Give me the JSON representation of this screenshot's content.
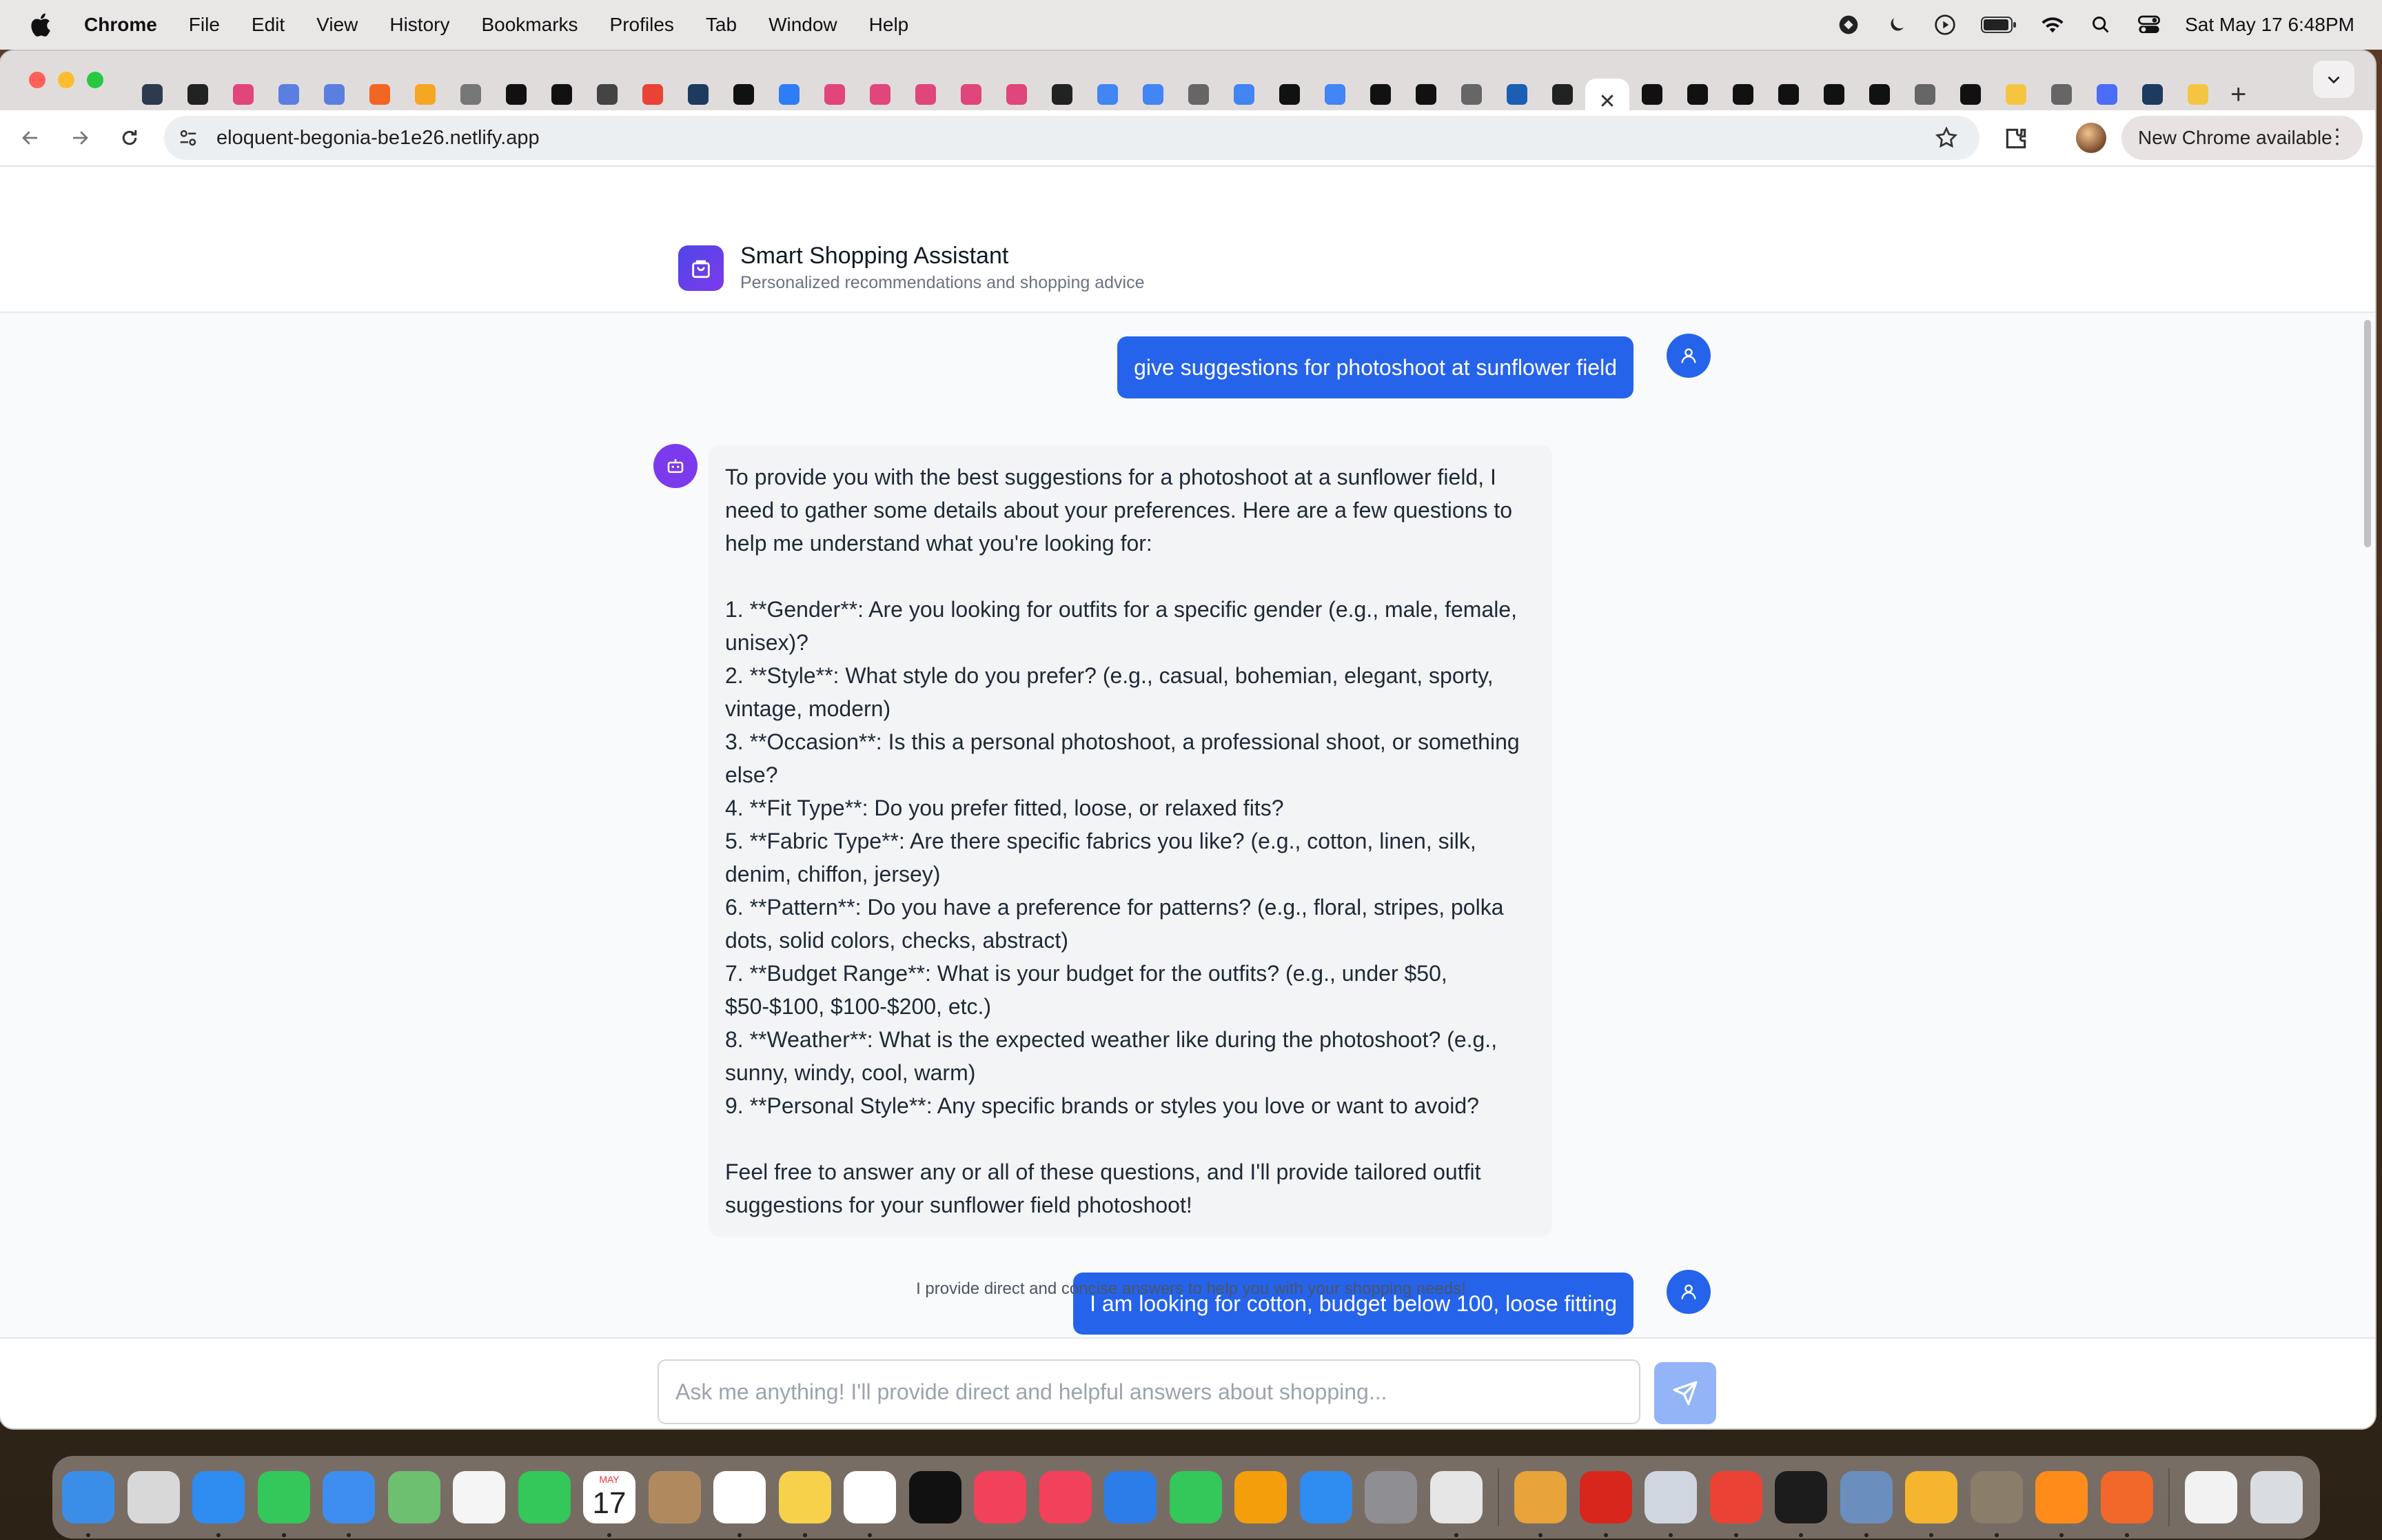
{
  "menubar": {
    "app_name": "Chrome",
    "items": [
      "File",
      "Edit",
      "View",
      "History",
      "Bookmarks",
      "Profiles",
      "Tab",
      "Window",
      "Help"
    ],
    "clock": "Sat May 17  6:48PM"
  },
  "browser": {
    "url": "eloquent-begonia-be1e26.netlify.app",
    "update_label": "New Chrome available",
    "active_tab_close": "✕",
    "new_tab": "+"
  },
  "tab_favicons": [
    "#2e3b4e",
    "#222222",
    "#e0457b",
    "#5b7fe0",
    "#5b7fe0",
    "#f26522",
    "#f5a623",
    "#777777",
    "#111111",
    "#111111",
    "#444444",
    "#ea4335",
    "#1e3a5f",
    "#111111",
    "#2f7df6",
    "#e0457b",
    "#e0457b",
    "#e0457b",
    "#e0457b",
    "#e0457b",
    "#222222",
    "#4285f4",
    "#4285f4",
    "#666666",
    "#4285f4",
    "#111111",
    "#4285f4",
    "#111111",
    "#111111",
    "#666666",
    "#1a5fb4",
    "#222222"
  ],
  "tab_favicons_after": [
    "#111111",
    "#111111",
    "#111111",
    "#111111",
    "#111111",
    "#111111",
    "#666666",
    "#111111",
    "#f5c542",
    "#666666",
    "#4a6cf7",
    "#1e3a5f",
    "#f5c542"
  ],
  "app": {
    "title": "Smart Shopping Assistant",
    "subtitle": "Personalized recommendations and shopping advice"
  },
  "messages": {
    "user_1": "give suggestions for photoshoot at sunflower field",
    "bot_1": "To provide you with the best suggestions for a photoshoot at a sunflower field, I need to gather some details about your preferences. Here are a few questions to help me understand what you're looking for:\n\n1. **Gender**: Are you looking for outfits for a specific gender (e.g., male, female, unisex)?\n2. **Style**: What style do you prefer? (e.g., casual, bohemian, elegant, sporty, vintage, modern)\n3. **Occasion**: Is this a personal photoshoot, a professional shoot, or something else?\n4. **Fit Type**: Do you prefer fitted, loose, or relaxed fits?\n5. **Fabric Type**: Are there specific fabrics you like? (e.g., cotton, linen, silk, denim, chiffon, jersey)\n6. **Pattern**: Do you have a preference for patterns? (e.g., floral, stripes, polka dots, solid colors, checks, abstract)\n7. **Budget Range**: What is your budget for the outfits? (e.g., under $50, $50-$100, $100-$200, etc.)\n8. **Weather**: What is the expected weather like during the photoshoot? (e.g., sunny, windy, cool, warm)\n9. **Personal Style**: Any specific brands or styles you love or want to avoid?\n\nFeel free to answer any or all of these questions, and I'll provide tailored outfit suggestions for your sunflower field photoshoot!",
    "user_2": "I am looking for cotton, budget below 100, loose fitting"
  },
  "composer": {
    "placeholder": "Ask me anything! I'll provide direct and helpful answers about shopping...",
    "value": "",
    "hint": "I provide direct and concise answers to help you with your shopping needs!"
  },
  "dock": {
    "calendar_month": "MAY",
    "calendar_day": "17",
    "apps": [
      {
        "name": "finder",
        "color": "#3b8ee8"
      },
      {
        "name": "launchpad",
        "color": "#d8d8d8"
      },
      {
        "name": "safari",
        "color": "#2f8cf0"
      },
      {
        "name": "messages",
        "color": "#34c759"
      },
      {
        "name": "mail",
        "color": "#3d8ef0"
      },
      {
        "name": "maps",
        "color": "#6cc070"
      },
      {
        "name": "photos",
        "color": "#f5f5f5"
      },
      {
        "name": "facetime",
        "color": "#34c759"
      },
      {
        "name": "calendar",
        "color": "#ffffff"
      },
      {
        "name": "contacts",
        "color": "#b08a5e"
      },
      {
        "name": "reminders",
        "color": "#ffffff"
      },
      {
        "name": "notes",
        "color": "#f7d14a"
      },
      {
        "name": "freeform",
        "color": "#ffffff"
      },
      {
        "name": "tv",
        "color": "#111111"
      },
      {
        "name": "music",
        "color": "#f2415a"
      },
      {
        "name": "news",
        "color": "#f2415a"
      },
      {
        "name": "keynote",
        "color": "#2b7de9"
      },
      {
        "name": "numbers",
        "color": "#34c759"
      },
      {
        "name": "pages",
        "color": "#f59e0b"
      },
      {
        "name": "app-store",
        "color": "#2f8cf0"
      },
      {
        "name": "system-settings",
        "color": "#8e8e93"
      },
      {
        "name": "python",
        "color": "#e6e6e6"
      }
    ],
    "apps_after": [
      {
        "name": "chrome-canary",
        "color": "#e8a33a"
      },
      {
        "name": "acrobat",
        "color": "#d9261c"
      },
      {
        "name": "rocket",
        "color": "#cfd6e0"
      },
      {
        "name": "chrome",
        "color": "#ea4335"
      },
      {
        "name": "terminal",
        "color": "#1c1c1c"
      },
      {
        "name": "preview",
        "color": "#6a8fbf"
      },
      {
        "name": "chrome-beta",
        "color": "#f5b52e"
      },
      {
        "name": "gimp",
        "color": "#8a7d6a"
      },
      {
        "name": "sublime-text",
        "color": "#ff8c1a"
      },
      {
        "name": "pen-app",
        "color": "#f2672a"
      }
    ],
    "apps_trailing": [
      {
        "name": "downloads",
        "color": "#f2f2f2"
      },
      {
        "name": "trash",
        "color": "#d9dde2"
      }
    ]
  }
}
